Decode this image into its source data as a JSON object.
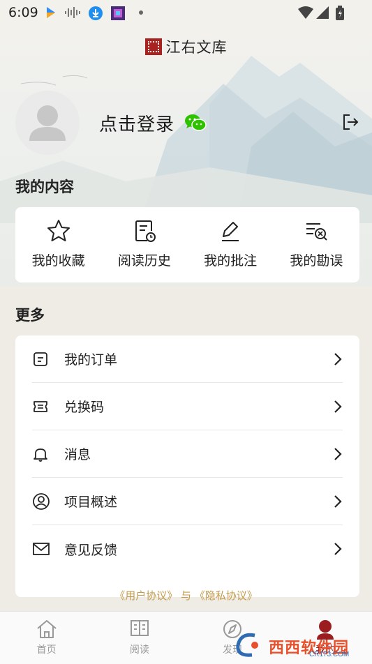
{
  "status_bar": {
    "time": "6:09"
  },
  "header": {
    "app_title": "江右文库"
  },
  "profile": {
    "login_text": "点击登录"
  },
  "my_content": {
    "title": "我的内容",
    "items": [
      {
        "label": "我的收藏",
        "icon": "star-icon"
      },
      {
        "label": "阅读历史",
        "icon": "history-icon"
      },
      {
        "label": "我的批注",
        "icon": "annotate-icon"
      },
      {
        "label": "我的勘误",
        "icon": "erratum-icon"
      }
    ]
  },
  "more": {
    "title": "更多",
    "items": [
      {
        "label": "我的订单",
        "icon": "order-icon"
      },
      {
        "label": "兑换码",
        "icon": "ticket-icon"
      },
      {
        "label": "消息",
        "icon": "bell-icon"
      },
      {
        "label": "项目概述",
        "icon": "user-circle-icon"
      },
      {
        "label": "意见反馈",
        "icon": "mail-icon"
      }
    ]
  },
  "agreement": {
    "user_agreement": "《用户协议》",
    "and": "与",
    "privacy_policy": "《隐私协议》"
  },
  "tabs": [
    {
      "label": "首页",
      "icon": "home-icon"
    },
    {
      "label": "阅读",
      "icon": "book-icon"
    },
    {
      "label": "发现",
      "icon": "compass-icon"
    },
    {
      "label": "我的",
      "icon": "profile-icon"
    }
  ],
  "watermark": {
    "text": "西西软件园",
    "sub": "CR173.COM"
  },
  "colors": {
    "accent": "#9c1d20",
    "link": "#c39a4a",
    "wechat": "#2dc100"
  }
}
